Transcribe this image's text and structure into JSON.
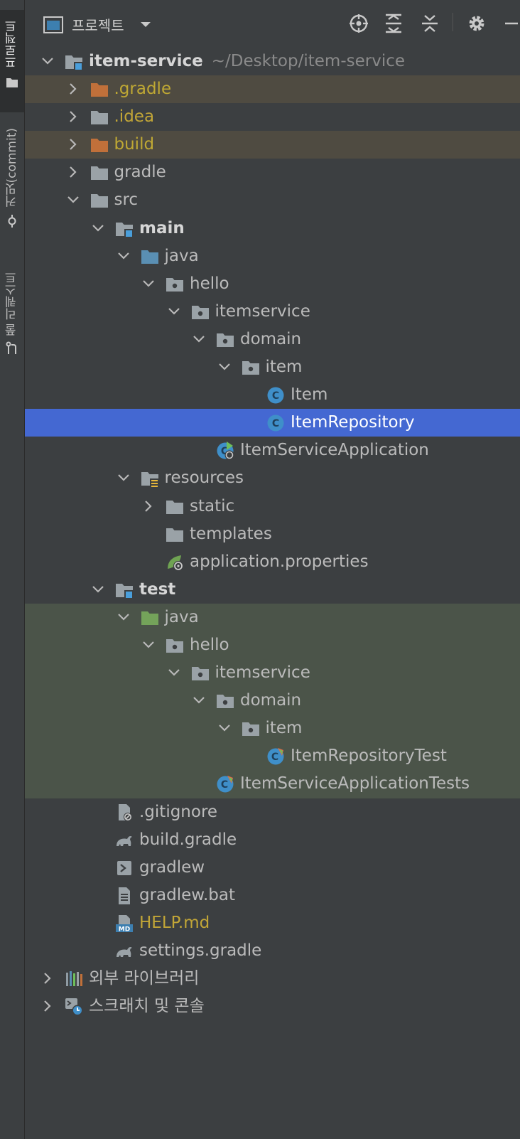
{
  "sidebar": {
    "tabs": [
      {
        "label": "프로젝트",
        "icon": "folder-icon",
        "active": true
      },
      {
        "label": "커밋(commit)",
        "icon": "commit-icon",
        "active": false
      },
      {
        "label": "풀 리퀘스트",
        "icon": "pull-request-icon",
        "active": false
      }
    ]
  },
  "toolbar": {
    "view_label": "프로젝트",
    "buttons": [
      "locate-icon",
      "expand-all-icon",
      "collapse-all-icon",
      "gear-icon"
    ]
  },
  "colors": {
    "background": "#3c3f41",
    "selected": "#4468d2",
    "excluded_bg": "#4f4b41",
    "test_bg": "#4b5449",
    "excluded_text": "#bfa834"
  },
  "tree": [
    {
      "label": "item-service",
      "path": "~/Desktop/item-service",
      "icon": "module-folder-icon"
    },
    {
      "label": ".gradle",
      "icon": "excluded-folder-icon"
    },
    {
      "label": ".idea",
      "icon": "folder-icon"
    },
    {
      "label": "build",
      "icon": "excluded-folder-icon"
    },
    {
      "label": "gradle",
      "icon": "folder-icon"
    },
    {
      "label": "src",
      "icon": "folder-icon"
    },
    {
      "label": "main",
      "icon": "module-folder-icon"
    },
    {
      "label": "java",
      "icon": "source-folder-icon"
    },
    {
      "label": "hello",
      "icon": "package-icon"
    },
    {
      "label": "itemservice",
      "icon": "package-icon"
    },
    {
      "label": "domain",
      "icon": "package-icon"
    },
    {
      "label": "item",
      "icon": "package-icon"
    },
    {
      "label": "Item",
      "icon": "class-icon"
    },
    {
      "label": "ItemRepository",
      "icon": "class-icon"
    },
    {
      "label": "ItemServiceApplication",
      "icon": "spring-boot-class-icon"
    },
    {
      "label": "resources",
      "icon": "resources-folder-icon"
    },
    {
      "label": "static",
      "icon": "folder-icon"
    },
    {
      "label": "templates",
      "icon": "folder-icon"
    },
    {
      "label": "application.properties",
      "icon": "spring-properties-icon"
    },
    {
      "label": "test",
      "icon": "module-folder-icon"
    },
    {
      "label": "java",
      "icon": "test-source-folder-icon"
    },
    {
      "label": "hello",
      "icon": "package-icon"
    },
    {
      "label": "itemservice",
      "icon": "package-icon"
    },
    {
      "label": "domain",
      "icon": "package-icon"
    },
    {
      "label": "item",
      "icon": "package-icon"
    },
    {
      "label": "ItemRepositoryTest",
      "icon": "test-class-icon"
    },
    {
      "label": "ItemServiceApplicationTests",
      "icon": "test-class-icon"
    },
    {
      "label": ".gitignore",
      "icon": "ignore-file-icon"
    },
    {
      "label": "build.gradle",
      "icon": "gradle-icon"
    },
    {
      "label": "gradlew",
      "icon": "shell-script-icon"
    },
    {
      "label": "gradlew.bat",
      "icon": "text-file-icon"
    },
    {
      "label": "HELP.md",
      "icon": "markdown-icon"
    },
    {
      "label": "settings.gradle",
      "icon": "gradle-icon"
    },
    {
      "label": "외부 라이브러리",
      "icon": "external-libraries-icon"
    },
    {
      "label": "스크래치 및 콘솔",
      "icon": "scratches-icon"
    }
  ]
}
